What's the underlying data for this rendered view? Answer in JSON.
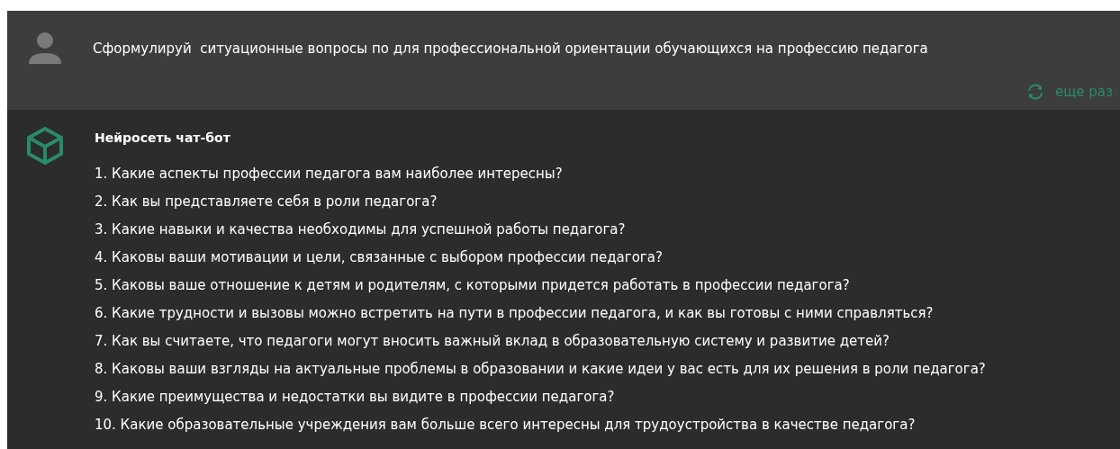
{
  "user_message": {
    "text": "Сформулируй  ситуационные вопросы по для профессиональной ориентации обучающихся на профессию педагога",
    "retry_label": "еще раз"
  },
  "bot_message": {
    "author": "Нейросеть чат-бот",
    "lines": [
      "1. Какие аспекты профессии педагога вам наиболее интересны?",
      "2. Как вы представляете себя в роли педагога?",
      "3. Какие навыки и качества необходимы для успешной работы педагога?",
      "4. Каковы ваши мотивации и цели, связанные с выбором профессии педагога?",
      "5. Каковы ваше отношение к детям и родителям, с которыми придется работать в профессии педагога?",
      "6. Какие трудности и вызовы можно встретить на пути в профессии педагога, и как вы готовы с ними справляться?",
      "7. Как вы считаете, что педагоги могут вносить важный вклад в образовательную систему и развитие детей?",
      "8. Каковы ваши взгляды на актуальные проблемы в образовании и какие идеи у вас есть для их решения в роли педагога?",
      "9. Какие преимущества и недостатки вы видите в профессии педагога?",
      "10. Какие образовательные учреждения вам больше всего интересны для трудоустройства в качестве педагога?"
    ]
  }
}
